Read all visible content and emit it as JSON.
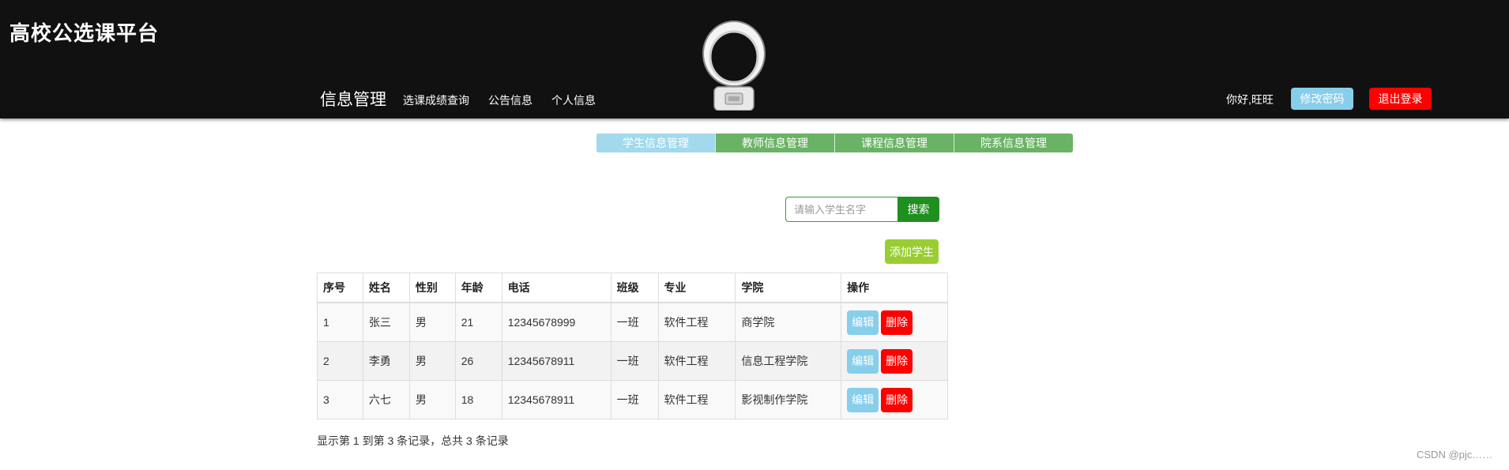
{
  "header": {
    "brand": "高校公选课平台",
    "nav_main": "信息管理",
    "nav_links": [
      "选课成绩查询",
      "公告信息",
      "个人信息"
    ],
    "greeting": "你好,旺旺",
    "change_password": "修改密码",
    "logout": "退出登录"
  },
  "subnav": {
    "tabs": [
      "学生信息管理",
      "教师信息管理",
      "课程信息管理",
      "院系信息管理"
    ],
    "active_index": 0
  },
  "search": {
    "placeholder": "请输入学生名字",
    "button": "搜索"
  },
  "add_button": "添加学生",
  "table": {
    "columns": [
      "序号",
      "姓名",
      "性别",
      "年龄",
      "电话",
      "班级",
      "专业",
      "学院",
      "操作"
    ],
    "rows": [
      [
        "1",
        "张三",
        "男",
        "21",
        "12345678999",
        "一班",
        "软件工程",
        "商学院"
      ],
      [
        "2",
        "李勇",
        "男",
        "26",
        "12345678911",
        "一班",
        "软件工程",
        "信息工程学院"
      ],
      [
        "3",
        "六七",
        "男",
        "18",
        "12345678911",
        "一班",
        "软件工程",
        "影视制作学院"
      ]
    ],
    "edit_label": "编辑",
    "delete_label": "删除"
  },
  "pagination_info": "显示第 1 到第 3 条记录，总共 3 条记录",
  "watermark": "CSDN @pjc……",
  "colors": {
    "topbar": "#111111",
    "subnav": "#6ab265",
    "subnav_active": "#a2d9ec",
    "search_button": "#1f8f1f",
    "add_button": "#9acd32",
    "edit_button": "#87ceeb",
    "delete_button": "#ff0000"
  }
}
